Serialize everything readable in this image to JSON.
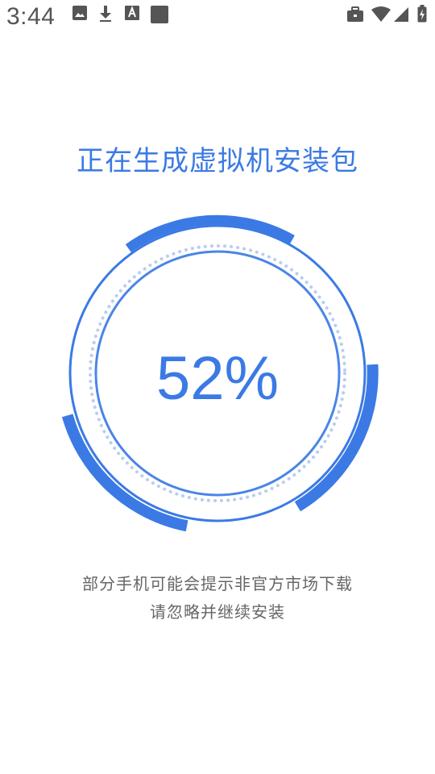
{
  "status_bar": {
    "time": "3:44",
    "left_icons": [
      "image-icon",
      "download-icon",
      "font-icon",
      "square-icon"
    ],
    "right_icons": [
      "briefcase-icon",
      "wifi-icon",
      "signal-icon",
      "battery-icon"
    ]
  },
  "main": {
    "title": "正在生成虚拟机安装包",
    "progress_percent": 52,
    "progress_label": "52%",
    "hint_line1": "部分手机可能会提示非官方市场下载",
    "hint_line2": "请忽略并继续安装"
  },
  "colors": {
    "accent": "#3b7ae4",
    "ring_light": "#b9cdee",
    "text_secondary": "#666666",
    "status_icon": "#555555"
  }
}
